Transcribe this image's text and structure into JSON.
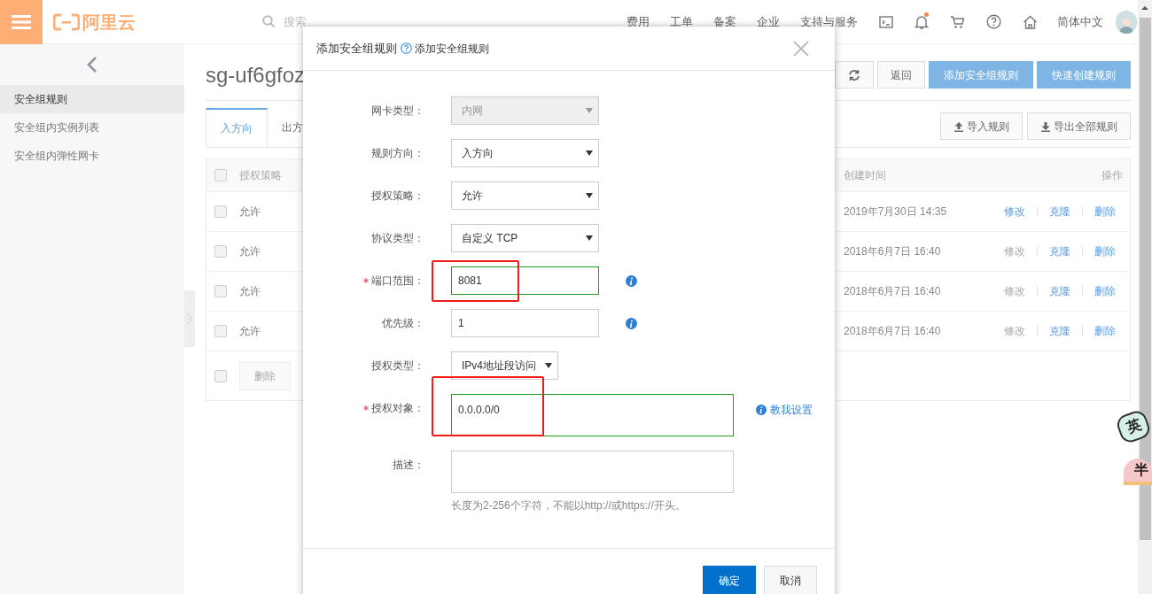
{
  "topbar": {
    "logo": "阿里云",
    "search": {
      "placeholder": "搜索"
    },
    "nav": [
      "费用",
      "工单",
      "备案",
      "企业",
      "支持与服务"
    ],
    "bell_dot": true,
    "language": "简体中文"
  },
  "sidebar": {
    "items": [
      {
        "label": "安全组规则",
        "selected": true
      },
      {
        "label": "安全组内实例列表",
        "selected": false
      },
      {
        "label": "安全组内弹性网卡",
        "selected": false
      }
    ]
  },
  "page": {
    "title": "sg-uf6gfoz",
    "buttons": [
      {
        "label": "返回",
        "kind": "default"
      },
      {
        "label": "添加安全组规则",
        "kind": "primary"
      },
      {
        "label": "快速创建规则",
        "kind": "primary"
      }
    ],
    "tabs": [
      {
        "label": "入方向",
        "selected": true
      },
      {
        "label": "出方",
        "selected": false
      }
    ],
    "rule_buttons": [
      {
        "label": "导入规则",
        "kind": "upload"
      },
      {
        "label": "导出全部规则",
        "kind": "download"
      }
    ]
  },
  "table": {
    "header_checked": false,
    "columns": [
      "授权策略",
      "创建时间",
      "操作"
    ],
    "rows": [
      {
        "checked": false,
        "policy": "允许",
        "created": "2019年7月30日 14:35",
        "actions": [
          {
            "label": "修改",
            "disabled": false
          },
          {
            "label": "克隆",
            "disabled": false
          },
          {
            "label": "删除",
            "disabled": false
          }
        ]
      },
      {
        "checked": false,
        "policy": "允许",
        "created": "2018年6月7日 16:40",
        "actions": [
          {
            "label": "修改",
            "disabled": true
          },
          {
            "label": "克隆",
            "disabled": false
          },
          {
            "label": "删除",
            "disabled": false
          }
        ]
      },
      {
        "checked": false,
        "policy": "允许",
        "created": "2018年6月7日 16:40",
        "actions": [
          {
            "label": "修改",
            "disabled": true
          },
          {
            "label": "克隆",
            "disabled": false
          },
          {
            "label": "删除",
            "disabled": false
          }
        ]
      },
      {
        "checked": false,
        "policy": "允许",
        "created": "2018年6月7日 16:40",
        "actions": [
          {
            "label": "修改",
            "disabled": true
          },
          {
            "label": "克隆",
            "disabled": false
          },
          {
            "label": "删除",
            "disabled": false
          }
        ]
      }
    ],
    "footer": {
      "checked": false,
      "button": {
        "label": "删除",
        "disabled": true
      }
    }
  },
  "dialog": {
    "title": "添加安全组规则",
    "help_link": "添加安全组规则",
    "fields": [
      {
        "label": "网卡类型：",
        "kind": "select",
        "value": "内网",
        "disabled": true,
        "required": false
      },
      {
        "label": "规则方向：",
        "kind": "select",
        "value": "入方向",
        "disabled": false,
        "required": false
      },
      {
        "label": "授权策略：",
        "kind": "select",
        "value": "允许",
        "disabled": false,
        "required": false
      },
      {
        "label": "协议类型：",
        "kind": "select",
        "value": "自定义 TCP",
        "disabled": false,
        "required": false
      },
      {
        "label": "端口范围：",
        "kind": "input",
        "value": "8081",
        "required": true,
        "valid": true,
        "info": true,
        "highlighted": true
      },
      {
        "label": "优先级：",
        "kind": "input",
        "value": "1",
        "required": false,
        "valid": false,
        "info": true,
        "highlighted": false
      },
      {
        "label": "授权类型：",
        "kind": "select",
        "value": "IPv4地址段访问",
        "disabled": false,
        "required": false,
        "narrow": true
      },
      {
        "label": "授权对象：",
        "kind": "textarea",
        "value": "0.0.0.0/0",
        "required": true,
        "valid": true,
        "highlighted": true,
        "link": "教我设置"
      },
      {
        "label": "描述：",
        "kind": "textarea",
        "required": false,
        "valid": false,
        "highlighted": false,
        "hint": "长度为2-256个字符，不能以http://或https://开头。"
      }
    ],
    "buttons": [
      {
        "label": "确定",
        "kind": "primary"
      },
      {
        "label": "取消",
        "kind": "default"
      }
    ]
  },
  "ime": [
    "英",
    "半"
  ]
}
